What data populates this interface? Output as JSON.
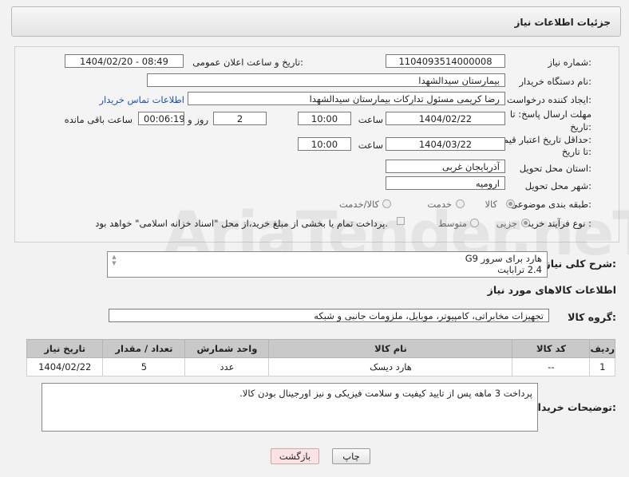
{
  "header": {
    "title": "جزئیات اطلاعات نیاز"
  },
  "form": {
    "need_number_label": "شماره نیاز:",
    "need_number": "1104093514000008",
    "announce_label": "تاریخ و ساعت اعلان عمومی:",
    "announce_value": "1404/02/20 - 08:49",
    "buyer_org_label": "نام دستگاه خریدار:",
    "buyer_org": "بیمارستان سیدالشهدا",
    "creator_label": "ایجاد کننده درخواست:",
    "creator": "رضا کریمی مسئول تدارکات بیمارستان سیدالشهدا",
    "contact_link": "اطلاعات تماس خریدار",
    "deadline_label_1": "مهلت ارسال پاسخ: تا",
    "deadline_label_2": "تاریخ:",
    "deadline_date": "1404/02/22",
    "time_label": "ساعت",
    "deadline_time": "10:00",
    "days_value": "2",
    "days_label": "روز و",
    "remaining_value": "00:06:19",
    "remaining_label": "ساعت باقی مانده",
    "price_label_1": "حداقل تاریخ اعتبار قیمت:",
    "price_label_2": "تا تاریخ:",
    "price_date": "1404/03/22",
    "price_time": "10:00",
    "province_label": "استان محل تحویل:",
    "province": "آذربایجان غربی",
    "city_label": "شهر محل تحویل:",
    "city": "ارومیه",
    "category_label": "طبقه بندی موضوعی:",
    "category_options": [
      "کالا",
      "خدمت",
      "کالا/خدمت"
    ],
    "process_label": "نوع فرآیند خرید :",
    "process_options": [
      "جزیی",
      "متوسط"
    ],
    "payment_note": "پرداخت تمام یا بخشی از مبلغ خرید،از محل \"اسناد خزانه اسلامی\" خواهد بود."
  },
  "watermark": "AriaTender.neT",
  "description": {
    "label": "شرح کلی نیاز:",
    "lines": [
      "هارد برای سرور G9",
      "2.4 ترابایت"
    ]
  },
  "goods_section": {
    "title": "اطلاعات کالاهای مورد نیاز",
    "group_label": "گروه کالا:",
    "group_value": "تجهیزات مخابراتی، کامپیوتر، موبایل، ملزومات جانبی و شبکه"
  },
  "table": {
    "headers": [
      "ردیف",
      "کد کالا",
      "نام کالا",
      "واحد شمارش",
      "تعداد / مقدار",
      "تاریخ نیاز"
    ],
    "rows": [
      [
        "1",
        "--",
        "هارد دیسک",
        "عدد",
        "5",
        "1404/02/22"
      ]
    ]
  },
  "buyer_notes": {
    "label": "توضیحات خریدار:",
    "text": "پرداخت 3 ماهه پس از تایید کیفیت و سلامت فیزیکی و نیز اورجینال بودن کالا."
  },
  "buttons": {
    "print": "چاپ",
    "back": "بازگشت"
  },
  "colors": {
    "link": "#1f4fb6",
    "back_button_bg": "#fbe3e3",
    "table_header_bg": "#c9c9c9"
  }
}
